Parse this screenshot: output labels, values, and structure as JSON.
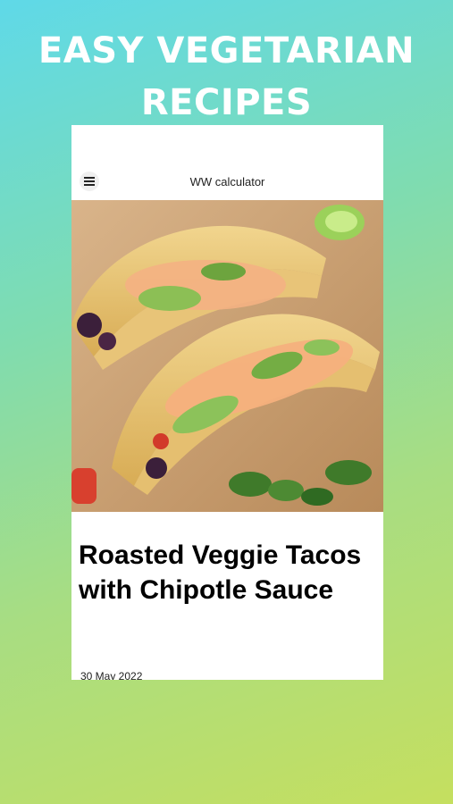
{
  "banner": {
    "line1": "EASY VEGETARIAN",
    "line2": "RECIPES"
  },
  "app": {
    "title": "WW calculator",
    "menu_icon": "hamburger-menu-icon"
  },
  "post": {
    "image_alt": "roasted-veggie-tacos-photo",
    "title": "Roasted Veggie Tacos with Chipotle Sauce",
    "date": "30 May 2022"
  },
  "colors": {
    "gradient_top": "#5fd9e8",
    "gradient_bottom": "#c5df5f",
    "card": "#ffffff"
  }
}
